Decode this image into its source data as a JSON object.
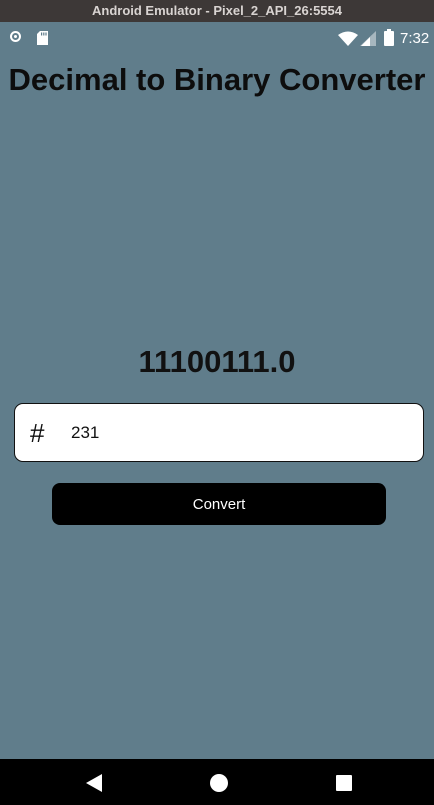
{
  "window": {
    "title": "Android Emulator - Pixel_2_API_26:5554"
  },
  "statusbar": {
    "time": "7:32",
    "icons": [
      "record-icon",
      "sd-card-icon",
      "wifi-icon",
      "signal-icon",
      "battery-icon"
    ]
  },
  "app": {
    "title": "Decimal to Binary Converter",
    "result": "11100111.0",
    "input": {
      "icon": "hash-icon",
      "value": "231"
    },
    "convert_label": "Convert"
  },
  "navbar": {
    "icons": [
      "back-icon",
      "home-icon",
      "recents-icon"
    ]
  },
  "colors": {
    "background": "#607d8b",
    "titlebar": "#3d3837",
    "button": "#000000",
    "input_background": "#ffffff"
  }
}
